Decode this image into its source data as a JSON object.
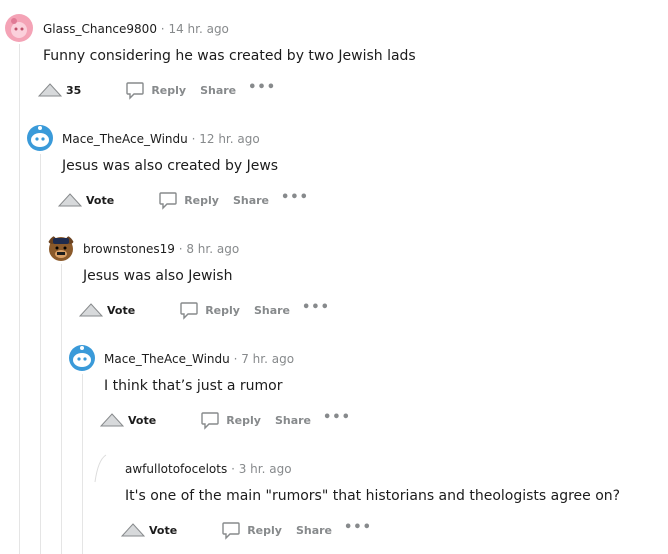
{
  "comments": [
    {
      "username": "Glass_Chance9800",
      "separator": "·",
      "timestamp": "14 hr. ago",
      "body": "Funny considering he was created by two Jewish lads",
      "vote": "35",
      "reply": "Reply",
      "share": "Share",
      "more": "•••",
      "avatar": "pink-avatar"
    },
    {
      "username": "Mace_TheAce_Windu",
      "separator": "·",
      "timestamp": "12 hr. ago",
      "body": "Jesus was also created by Jews",
      "vote": "Vote",
      "reply": "Reply",
      "share": "Share",
      "more": "•••",
      "avatar": "blue-snoo-avatar"
    },
    {
      "username": "brownstones19",
      "separator": "·",
      "timestamp": "8 hr. ago",
      "body": "Jesus was also Jewish",
      "vote": "Vote",
      "reply": "Reply",
      "share": "Share",
      "more": "•••",
      "avatar": "brown-bear-avatar"
    },
    {
      "username": "Mace_TheAce_Windu",
      "separator": "·",
      "timestamp": "7 hr. ago",
      "body": "I think that’s just a rumor",
      "vote": "Vote",
      "reply": "Reply",
      "share": "Share",
      "more": "•••",
      "avatar": "blue-snoo-avatar"
    },
    {
      "username": "awfullotofocelots",
      "separator": "·",
      "timestamp": "3 hr. ago",
      "body": "It's one of the main \"rumors\" that historians and theologists agree on?",
      "vote": "Vote",
      "reply": "Reply",
      "share": "Share",
      "more": "•••",
      "avatar": "none"
    }
  ],
  "colors": {
    "meta": "#878a8c",
    "line": "#e5e5e5",
    "text": "#1c1c1c",
    "avatar_blue": "#3a9ad9",
    "avatar_pink": "#f4a3b6",
    "avatar_brown": "#8b5a2b"
  }
}
